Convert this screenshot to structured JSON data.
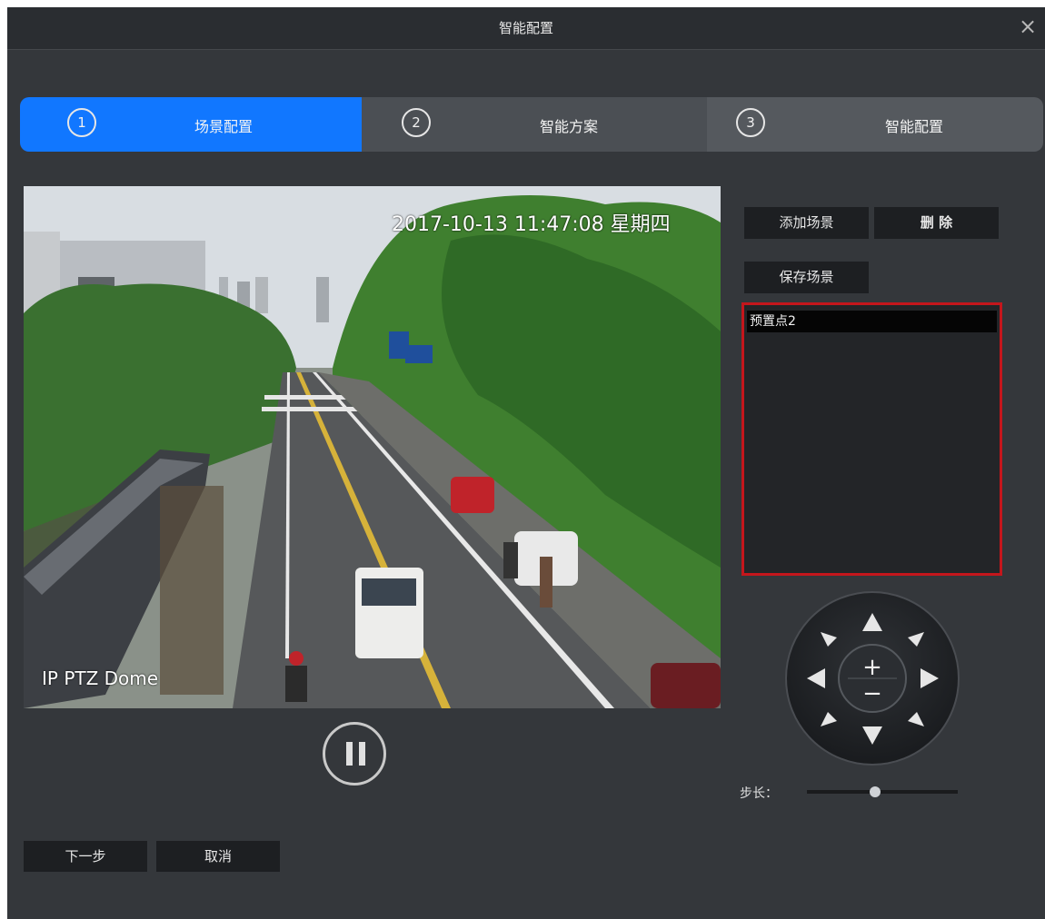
{
  "dialog": {
    "title": "智能配置",
    "close_label": "×"
  },
  "steps": [
    {
      "number": "1",
      "label": "场景配置",
      "active": true
    },
    {
      "number": "2",
      "label": "智能方案",
      "active": false
    },
    {
      "number": "3",
      "label": "智能配置",
      "active": false
    }
  ],
  "video": {
    "timestamp": "2017-10-13 11:47:08 星期四",
    "camera_name": "IP PTZ Dome",
    "state": "playing"
  },
  "scene_panel": {
    "add_label": "添加场景",
    "delete_label": "删 除",
    "save_label": "保存场景",
    "scenes": [
      "预置点2"
    ],
    "selected_scene": "预置点2"
  },
  "ptz": {
    "zoom_in": "+",
    "zoom_out": "−"
  },
  "step_length": {
    "label": "步长：",
    "level": 0.45
  },
  "footer": {
    "next_label": "下一步",
    "cancel_label": "取消"
  },
  "colors": {
    "accent": "#1177ff",
    "highlight_border": "#c4161c",
    "background": "#34373b"
  }
}
